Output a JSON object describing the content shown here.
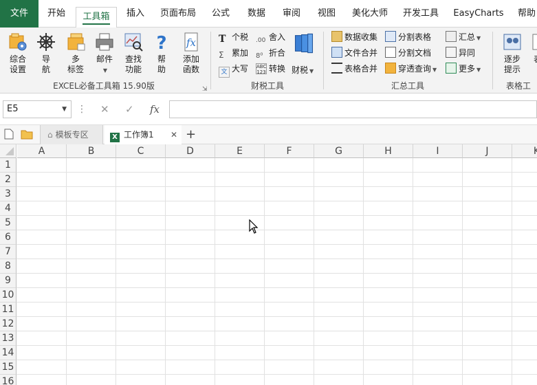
{
  "menubar": {
    "tabs": [
      "文件",
      "开始",
      "工具箱",
      "插入",
      "页面布局",
      "公式",
      "数据",
      "审阅",
      "视图",
      "美化大师",
      "开发工具",
      "EasyCharts",
      "帮助"
    ],
    "active_index": 2
  },
  "ribbon": {
    "excel_group": {
      "label": "EXCEL必备工具箱 15.90版",
      "buttons": [
        [
          "综合",
          "设置"
        ],
        [
          "导",
          "航"
        ],
        [
          "多",
          "标签"
        ],
        [
          "邮件"
        ],
        [
          "查找",
          "功能"
        ],
        [
          "帮",
          "助"
        ],
        [
          "添加",
          "函数"
        ]
      ]
    },
    "tax_group": {
      "label": "财税工具",
      "items": [
        "个税",
        "舍入",
        "累加",
        "折合",
        "大写",
        "转换"
      ],
      "big": "财税"
    },
    "sum_group": {
      "label": "汇总工具",
      "items": [
        "数据收集",
        "分割表格",
        "汇总",
        "文件合并",
        "分割文档",
        "异同",
        "表格合并",
        "穿透查询",
        "更多"
      ]
    },
    "table_group": {
      "label": "表格工",
      "big": [
        "逐步",
        "提示"
      ],
      "partial": "表"
    }
  },
  "formula_bar": {
    "namebox": "E5",
    "cancel": "✕",
    "confirm": "✓",
    "fx": "fx",
    "value": ""
  },
  "doc_tabs": {
    "template": "模板专区",
    "workbook": "工作簿1",
    "close": "✕",
    "add": "+"
  },
  "sheet": {
    "columns": [
      "A",
      "B",
      "C",
      "D",
      "E",
      "F",
      "G",
      "H",
      "I",
      "J",
      "K"
    ],
    "rows": [
      "1",
      "2",
      "3",
      "4",
      "5",
      "6",
      "7",
      "8",
      "9",
      "10",
      "11",
      "12",
      "13",
      "14",
      "15",
      "16"
    ]
  },
  "colors": {
    "accent": "#217346"
  }
}
